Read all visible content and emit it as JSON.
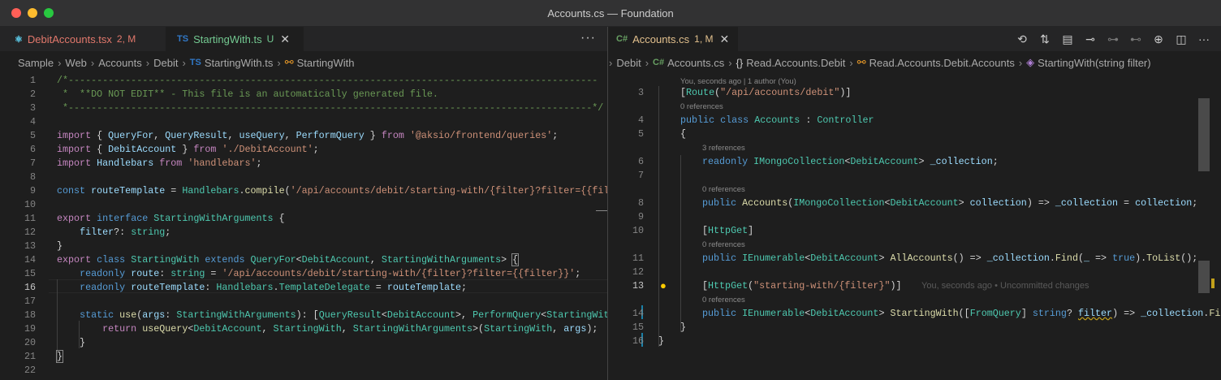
{
  "window": {
    "title": "Accounts.cs — Foundation",
    "traffic_lights": {
      "close": "#ff5f57",
      "minimize": "#febc2e",
      "zoom": "#28c840"
    }
  },
  "left_editor": {
    "tabs": [
      {
        "icon": "react-icon",
        "name": "DebitAccounts.tsx",
        "status": "2, M",
        "color": "#e2786c"
      },
      {
        "icon": "ts",
        "name": "StartingWith.ts",
        "status": "U",
        "color": "#73c991"
      }
    ],
    "more_label": "···",
    "breadcrumb": [
      "Sample",
      "Web",
      "Accounts",
      "Debit",
      "StartingWith.ts",
      "StartingWith"
    ],
    "breadcrumb_icons": {
      "ts": "TS",
      "symbol": "{ }"
    }
  },
  "right_editor": {
    "tab": {
      "icon": "C#",
      "name": "Accounts.cs",
      "status": "1, M",
      "color": "#e2c08d"
    },
    "breadcrumb": [
      "Debit",
      "Accounts.cs",
      "Read.Accounts.Debit",
      "Read.Accounts.Debit.Accounts",
      "StartingWith(string filter)"
    ],
    "breadcrumb_icons": {
      "cs": "C#",
      "ns": "{}"
    },
    "codelens": {
      "author": "You, seconds ago | 1 author (You)",
      "refs0": "0 references",
      "refs3": "3 references"
    },
    "blame": "You, seconds ago • Uncommitted changes"
  }
}
